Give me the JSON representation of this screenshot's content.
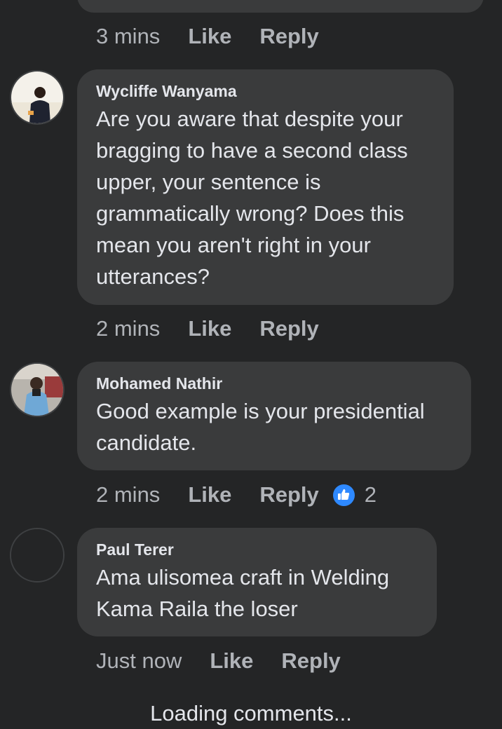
{
  "previous_comment": {
    "time": "3 mins",
    "like_label": "Like",
    "reply_label": "Reply"
  },
  "comments": [
    {
      "author": "Wycliffe Wanyama",
      "text": "Are you aware that despite your bragging to have a second class upper, your sentence is grammatically wrong? Does this mean you aren't right in your utterances?",
      "time": "2 mins",
      "like_label": "Like",
      "reply_label": "Reply",
      "avatar_icon": "profile-photo"
    },
    {
      "author": "Mohamed Nathir",
      "text": "Good example is your presidential candidate.",
      "time": "2 mins",
      "like_label": "Like",
      "reply_label": "Reply",
      "reaction_icon": "thumbs-up-icon",
      "reaction_count": "2",
      "avatar_icon": "profile-photo"
    },
    {
      "author": "Paul Terer",
      "text": "Ama ulisomea craft in Welding Kama Raila the loser",
      "time": "Just now",
      "like_label": "Like",
      "reply_label": "Reply",
      "avatar_icon": "empty-avatar"
    }
  ],
  "loading_text": "Loading comments...",
  "colors": {
    "background": "#242526",
    "bubble": "#3a3b3c",
    "primary_text": "#e4e6eb",
    "secondary_text": "#b0b3b8",
    "like_blue": "#2e89ff"
  }
}
